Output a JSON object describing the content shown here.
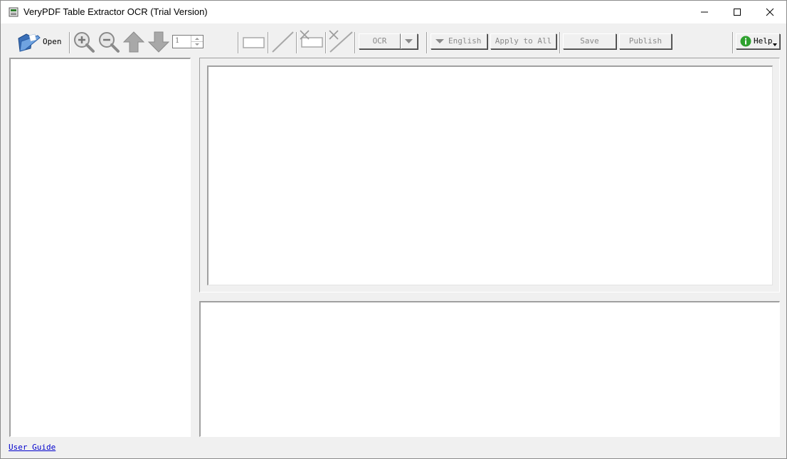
{
  "window": {
    "title": "VeryPDF Table Extractor OCR (Trial Version)",
    "controls": [
      "minimize",
      "maximize",
      "close"
    ]
  },
  "toolbar": {
    "open_label": "Open",
    "page_number": "1",
    "ocr_label": "OCR",
    "language_label": "English",
    "apply_all_label": "Apply to All",
    "save_label": "Save",
    "publish_label": "Publish",
    "help_label": "Help",
    "icons": [
      "folder-open-icon",
      "zoom-in-icon",
      "zoom-out-icon",
      "page-up-icon",
      "page-down-icon",
      "rectangle-tool-icon",
      "line-tool-icon",
      "delete-rectangle-icon",
      "delete-line-icon",
      "dropdown-arrow-icon",
      "info-icon"
    ]
  },
  "status": {
    "user_guide_link": "User Guide"
  },
  "colors": {
    "window_bg": "#f0f0f0",
    "panel_bg": "#ffffff",
    "link": "#0000cc",
    "help_icon": "#2fa12f"
  }
}
